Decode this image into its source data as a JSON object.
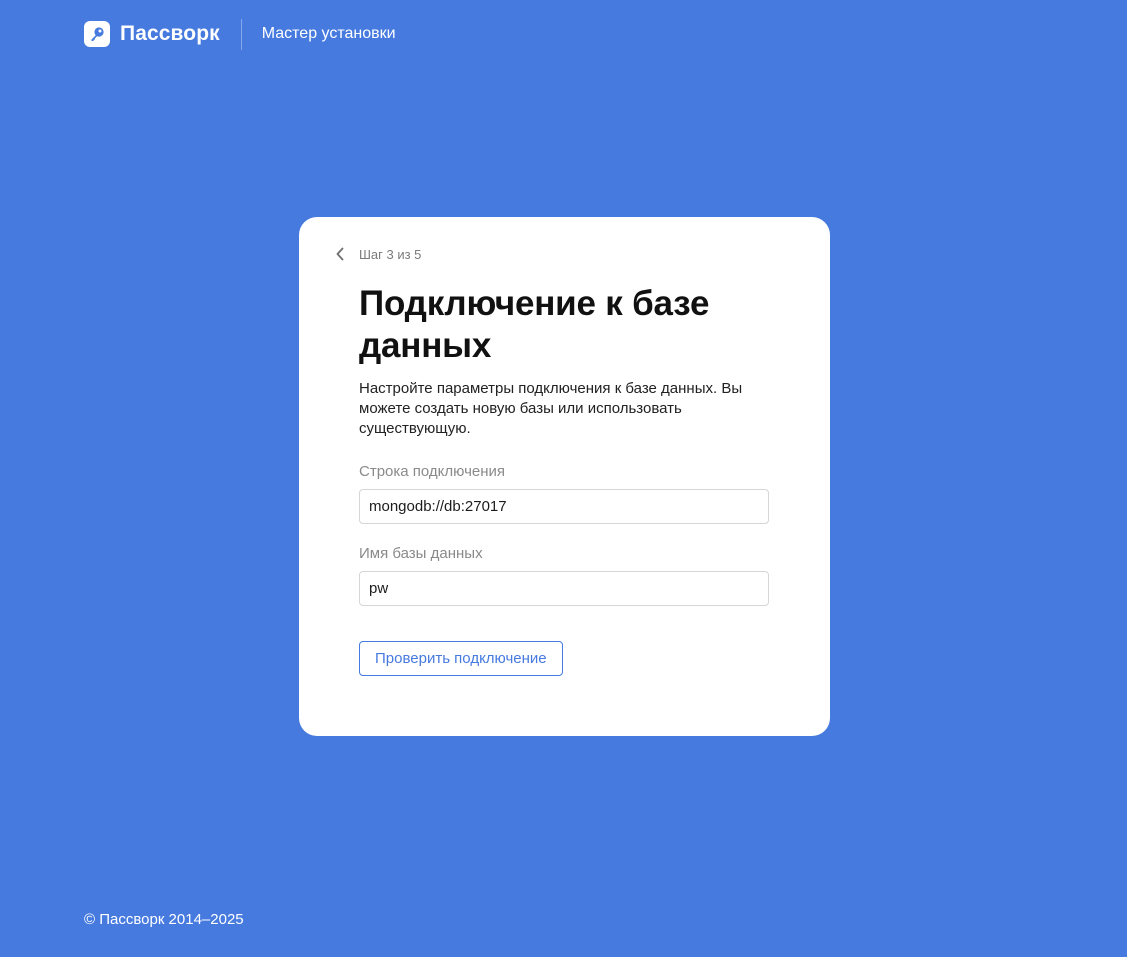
{
  "header": {
    "brand": "Пассворк",
    "subtitle": "Мастер установки"
  },
  "card": {
    "step": "Шаг 3 из 5",
    "title": "Подключение к базе данных",
    "description": "Настройте параметры подключения к базе данных. Вы можете создать новую базы или использовать существующую.",
    "connection_string": {
      "label": "Строка подключения",
      "value": "mongodb://db:27017"
    },
    "database_name": {
      "label": "Имя базы данных",
      "value": "pw"
    },
    "check_button": "Проверить подключение"
  },
  "footer": {
    "copyright": "© Пассворк 2014–2025"
  },
  "colors": {
    "background": "#467ADF",
    "accent": "#467ADF",
    "card": "#FFFFFF"
  },
  "icons": {
    "logo": "key-icon",
    "back": "chevron-left-icon"
  }
}
